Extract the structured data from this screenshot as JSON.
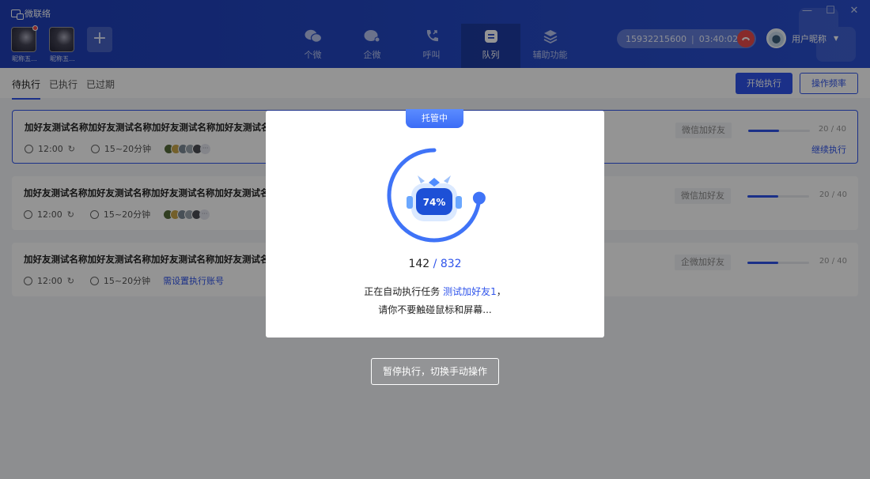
{
  "app": {
    "title": "微联络"
  },
  "window_controls": {
    "minimize": "—",
    "maximize": "☐",
    "close": "✕"
  },
  "accounts": [
    {
      "name": "昵称五...",
      "has_notification": true
    },
    {
      "name": "昵称五...",
      "has_notification": false
    }
  ],
  "add_account": {
    "label": "+"
  },
  "nav": [
    {
      "label": "个微",
      "icon": "wechat-icon",
      "active": false
    },
    {
      "label": "企微",
      "icon": "wecom-icon",
      "active": false
    },
    {
      "label": "呼叫",
      "icon": "phone-icon",
      "active": false
    },
    {
      "label": "队列",
      "icon": "queue-icon",
      "active": true
    },
    {
      "label": "辅助功能",
      "icon": "layers-icon",
      "active": false
    }
  ],
  "call": {
    "number": "15932215600",
    "separator": "|",
    "duration": "03:40:02"
  },
  "user": {
    "name": "用户昵称",
    "caret": "▼"
  },
  "tabs": [
    {
      "label": "待执行",
      "active": true
    },
    {
      "label": "已执行",
      "active": false
    },
    {
      "label": "已过期",
      "active": false
    }
  ],
  "toolbar": {
    "start_label": "开始执行",
    "frequency_label": "操作频率"
  },
  "tasks": [
    {
      "title": "加好友测试名称加好友测试名称加好友测试名称加好友测试名称加好友测试名...",
      "time": "12:00",
      "interval": "15~20分钟",
      "more": "···",
      "tag": "微信加好友",
      "progress": 0.5,
      "progress_text": "20 / 40",
      "action": "继续执行"
    },
    {
      "title": "加好友测试名称加好友测试名称加好友测试名称加好友测试名称加好友测试名称",
      "time": "12:00",
      "interval": "15~20分钟",
      "more": "···",
      "tag": "微信加好友",
      "progress": 0.5,
      "progress_text": "20 / 40"
    },
    {
      "title": "加好友测试名称加好友测试名称加好友测试名称加好友测试名称加好友测试名称",
      "time": "12:00",
      "interval": "15~20分钟",
      "account_note": "需设置执行账号",
      "tag": "企微加好友",
      "progress": 0.5,
      "progress_text": "20 / 40"
    }
  ],
  "modal": {
    "badge": "托管中",
    "percent": "74%",
    "progress_value": 0.74,
    "done": "142",
    "sep": " / ",
    "total": "832",
    "line1_prefix": "正在自动执行任务 ",
    "task_name": "测试加好友1",
    "line1_suffix": "，",
    "line2": "请你不要触碰鼠标和屏幕..."
  },
  "pause_button": "暂停执行，切换手动操作",
  "colors": {
    "primary": "#2f54eb",
    "header": "#2448c4",
    "danger": "#e84a4a"
  }
}
